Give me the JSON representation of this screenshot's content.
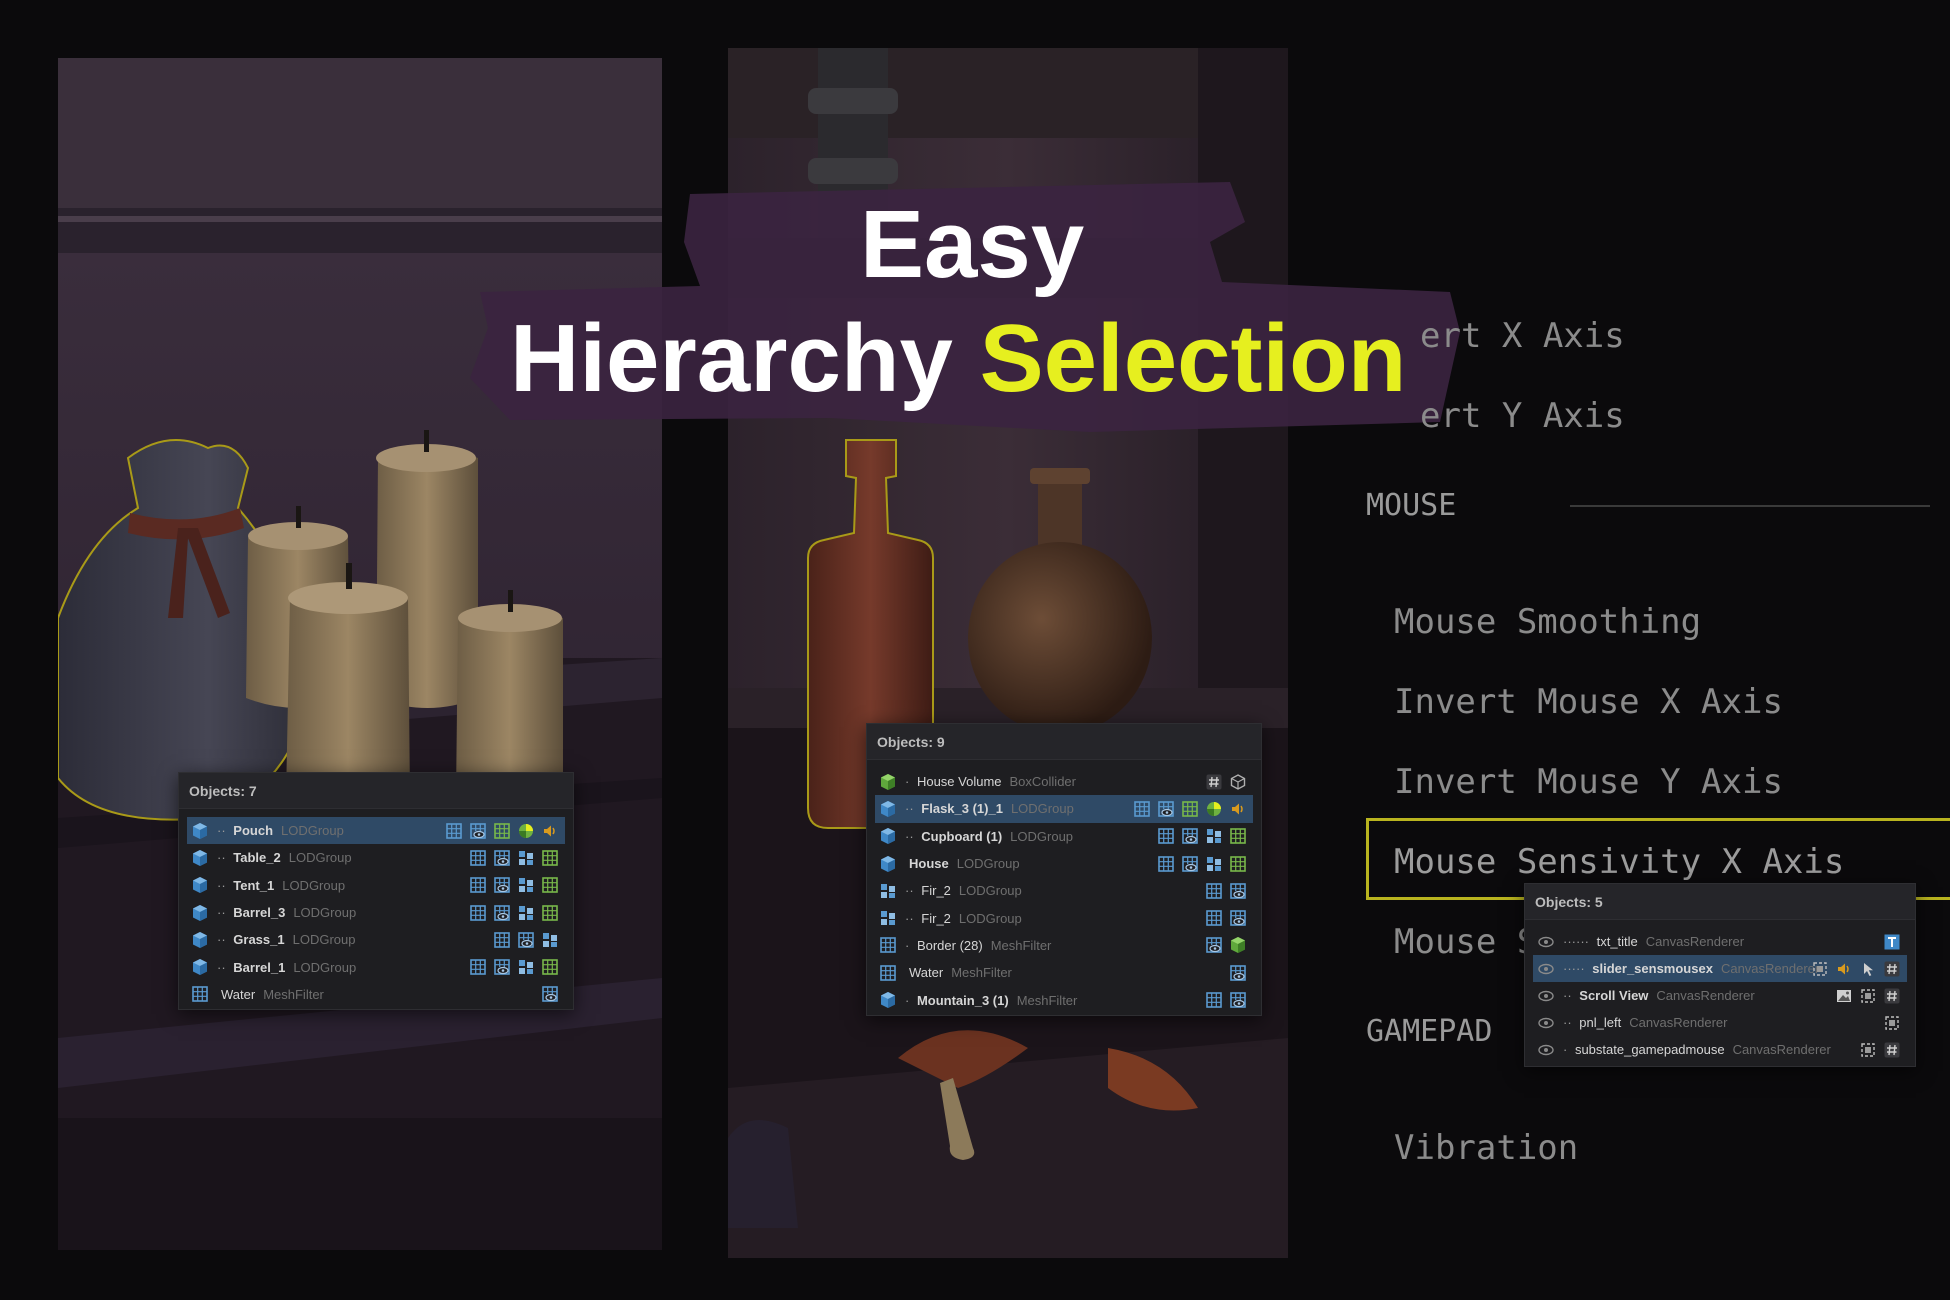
{
  "title": {
    "line1": "Easy",
    "line2_plain": "Hierarchy",
    "line2_highlight": "Selection",
    "highlight_color": "#e6ef1f"
  },
  "settings_menu": {
    "partial_items": [
      {
        "label": "ert X Axis"
      },
      {
        "label": "ert Y Axis"
      }
    ],
    "sections": [
      {
        "label": "MOUSE",
        "items": [
          {
            "label": "Mouse Smoothing"
          },
          {
            "label": "Invert Mouse X Axis"
          },
          {
            "label": "Invert Mouse Y Axis"
          },
          {
            "label": "Mouse Sensivity X Axis",
            "highlighted": true
          },
          {
            "label": "Mouse S"
          }
        ]
      },
      {
        "label": "GAMEPAD",
        "items": [
          {
            "label": "Vibration"
          }
        ]
      }
    ],
    "highlight_color": "#b9b41f"
  },
  "hierarchy_left": {
    "header": "Objects: 7",
    "rows": [
      {
        "prefix": "·· ",
        "name": "Pouch",
        "component": "LODGroup",
        "icon": "cube-icon",
        "selected": true,
        "comp_icons": [
          "mesh-grid-icon",
          "mesh-eye-icon",
          "green-grid-icon",
          "green-sphere-icon",
          "audio-icon"
        ]
      },
      {
        "prefix": "·· ",
        "name": "Table_2",
        "component": "LODGroup",
        "icon": "cube-icon",
        "comp_icons": [
          "mesh-grid-icon",
          "mesh-eye-icon",
          "prefab-icon",
          "green-grid-icon"
        ]
      },
      {
        "prefix": "·· ",
        "name": "Tent_1",
        "component": "LODGroup",
        "icon": "cube-icon",
        "comp_icons": [
          "mesh-grid-icon",
          "mesh-eye-icon",
          "prefab-icon",
          "green-grid-icon"
        ]
      },
      {
        "prefix": "·· ",
        "name": "Barrel_3",
        "component": "LODGroup",
        "icon": "cube-icon",
        "comp_icons": [
          "mesh-grid-icon",
          "mesh-eye-icon",
          "prefab-icon",
          "green-grid-icon"
        ]
      },
      {
        "prefix": "·· ",
        "name": "Grass_1",
        "component": "LODGroup",
        "icon": "cube-icon",
        "comp_icons": [
          "mesh-grid-icon",
          "mesh-eye-icon",
          "prefab-icon"
        ]
      },
      {
        "prefix": "·· ",
        "name": "Barrel_1",
        "component": "LODGroup",
        "icon": "cube-icon",
        "comp_icons": [
          "mesh-grid-icon",
          "mesh-eye-icon",
          "prefab-icon",
          "green-grid-icon"
        ]
      },
      {
        "prefix": "",
        "name": "Water",
        "component": "MeshFilter",
        "icon": "mesh-grid-icon",
        "light": true,
        "comp_icons": [
          "mesh-eye-icon"
        ]
      }
    ]
  },
  "hierarchy_mid": {
    "header": "Objects: 9",
    "rows": [
      {
        "prefix": "· ",
        "name": "House Volume",
        "component": "BoxCollider",
        "icon": "green-cube-icon",
        "light": true,
        "comp_icons": [
          "hash-icon",
          "box-collider-icon"
        ]
      },
      {
        "prefix": "·· ",
        "name": "Flask_3 (1)_1",
        "component": "LODGroup",
        "icon": "cube-icon",
        "selected": true,
        "comp_icons": [
          "mesh-grid-icon",
          "mesh-eye-icon",
          "green-grid-icon",
          "green-sphere-icon",
          "audio-icon"
        ]
      },
      {
        "prefix": "·· ",
        "name": "Cupboard (1)",
        "component": "LODGroup",
        "icon": "cube-icon",
        "comp_icons": [
          "mesh-grid-icon",
          "mesh-eye-icon",
          "prefab-icon",
          "green-grid-icon"
        ]
      },
      {
        "prefix": "",
        "name": "House",
        "component": "LODGroup",
        "icon": "cube-icon",
        "comp_icons": [
          "mesh-grid-icon",
          "mesh-eye-icon",
          "prefab-icon",
          "green-grid-icon"
        ]
      },
      {
        "prefix": "·· ",
        "name": "Fir_2",
        "component": "LODGroup",
        "icon": "prefab-icon",
        "light": true,
        "comp_icons": [
          "mesh-grid-icon",
          "mesh-eye-icon"
        ]
      },
      {
        "prefix": "·· ",
        "name": "Fir_2",
        "component": "LODGroup",
        "icon": "prefab-icon",
        "light": true,
        "comp_icons": [
          "mesh-grid-icon",
          "mesh-eye-icon"
        ]
      },
      {
        "prefix": "· ",
        "name": "Border (28)",
        "component": "MeshFilter",
        "icon": "mesh-grid-icon",
        "light": true,
        "comp_icons": [
          "mesh-eye-icon",
          "green-cube-icon"
        ]
      },
      {
        "prefix": "",
        "name": "Water",
        "component": "MeshFilter",
        "icon": "mesh-grid-icon",
        "light": true,
        "comp_icons": [
          "mesh-eye-icon"
        ]
      },
      {
        "prefix": "· ",
        "name": "Mountain_3 (1)",
        "component": "MeshFilter",
        "icon": "cube-icon",
        "comp_icons": [
          "mesh-grid-icon",
          "mesh-eye-icon"
        ]
      }
    ]
  },
  "hierarchy_right": {
    "header": "Objects: 5",
    "rows": [
      {
        "prefix": "······ ",
        "name": "txt_title",
        "component": "CanvasRenderer",
        "icon": "eye-icon",
        "light": true,
        "comp_icons": [
          "text-icon"
        ]
      },
      {
        "prefix": "····· ",
        "name": "slider_sensmousex",
        "component": "CanvasRenderer",
        "icon": "eye-icon",
        "selected": true,
        "comp_icons": [
          "rect-icon",
          "audio-icon",
          "cursor-icon",
          "hash-icon"
        ]
      },
      {
        "prefix": "·· ",
        "name": "Scroll View",
        "component": "CanvasRenderer",
        "icon": "eye-icon",
        "comp_icons": [
          "image-icon",
          "rect-icon",
          "hash-icon"
        ]
      },
      {
        "prefix": "·· ",
        "name": "pnl_left",
        "component": "CanvasRenderer",
        "icon": "eye-icon",
        "light": true,
        "comp_icons": [
          "rect-icon"
        ]
      },
      {
        "prefix": "· ",
        "name": "substate_gamepadmouse",
        "component": "CanvasRenderer",
        "icon": "eye-icon",
        "light": true,
        "comp_icons": [
          "rect-icon",
          "hash-icon"
        ]
      }
    ]
  }
}
